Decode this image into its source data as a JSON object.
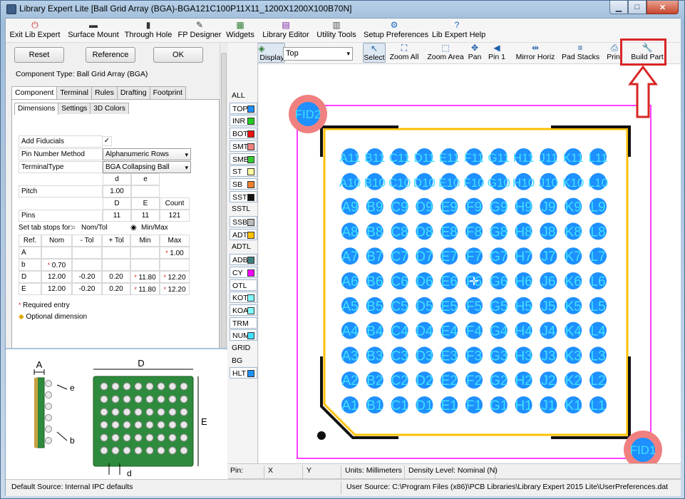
{
  "window": {
    "title": "Library Expert Lite [Ball Grid Array (BGA)-BGA121C100P11X11_1200X1200X100B70N]"
  },
  "menu": [
    {
      "label": "Exit Lib Expert",
      "icon": "power-icon",
      "icon_glyph": "⏻",
      "color": "#c92a2a"
    },
    {
      "label": "Surface Mount",
      "icon": "smd-chip-icon",
      "icon_glyph": "▬",
      "color": "#333"
    },
    {
      "label": "Through Hole",
      "icon": "through-hole-icon",
      "icon_glyph": "▮",
      "color": "#333"
    },
    {
      "label": "FP Designer",
      "icon": "footprint-designer-icon",
      "icon_glyph": "✎",
      "color": "#333"
    },
    {
      "label": "Widgets",
      "icon": "widgets-icon",
      "icon_glyph": "▦",
      "color": "#2e7d32"
    },
    {
      "label": "Library Editor",
      "icon": "library-editor-icon",
      "icon_glyph": "▤",
      "color": "#7b1fa2"
    },
    {
      "label": "Utility Tools",
      "icon": "utility-tools-icon",
      "icon_glyph": "▥",
      "color": "#555"
    },
    {
      "label": "Setup Preferences",
      "icon": "setup-preferences-icon",
      "icon_glyph": "⚙",
      "color": "#1565c0"
    },
    {
      "label": "Lib Expert Help",
      "icon": "help-icon",
      "icon_glyph": "?",
      "color": "#1565c0"
    }
  ],
  "buttons": {
    "reset": "Reset",
    "reference": "Reference",
    "ok": "OK"
  },
  "component_type": "Component Type: Ball Grid Array (BGA)",
  "tabs": [
    "Component",
    "Terminal",
    "Rules",
    "Drafting",
    "Footprint"
  ],
  "subtabs": [
    "Dimensions",
    "Settings",
    "3D Colors"
  ],
  "form": {
    "add_fiducials": "Add Fiducials",
    "pin_number_method_label": "Pin Number Method",
    "pin_number_method_value": "Alphanumeric Rows",
    "terminal_type_label": "TerminalType",
    "terminal_type_value": "BGA Collapsing Ball",
    "col_d": "d",
    "col_e": "e",
    "pitch_label": "Pitch",
    "pitch_value": "1.00",
    "col_D": "D",
    "col_E": "E",
    "col_count": "Count",
    "pins_label": "Pins",
    "pins_D": "11",
    "pins_E": "11",
    "pins_count": "121",
    "tab_stops_label": "Set tab stops for:",
    "radio_nom": "Nom/Tol",
    "radio_minmax": "Min/Max",
    "headers": [
      "Ref.",
      "Nom",
      "- Tol",
      "+ Tol",
      "Min",
      "Max"
    ],
    "rows": [
      {
        "ref": "A",
        "nom": "",
        "ntol": "",
        "ptol": "",
        "min": "",
        "max": "1.00",
        "max_req": true
      },
      {
        "ref": "b",
        "nom": "0.70",
        "nom_req": true,
        "ntol": "",
        "ptol": "",
        "min": "",
        "max": ""
      },
      {
        "ref": "D",
        "nom": "12.00",
        "ntol": "-0.20",
        "ptol": "0.20",
        "min": "11.80",
        "max": "12.20",
        "min_req": true,
        "max_req": true
      },
      {
        "ref": "E",
        "nom": "12.00",
        "ntol": "-0.20",
        "ptol": "0.20",
        "min": "11.80",
        "max": "12.20",
        "min_req": true,
        "max_req": true
      }
    ],
    "legend_required": "Required entry",
    "legend_optional": "Optional dimension"
  },
  "diagram_labels": {
    "A": "A",
    "D": "D",
    "E": "E",
    "e": "e",
    "b": "b",
    "d": "d"
  },
  "layers": [
    {
      "name": "ALL",
      "color": ""
    },
    {
      "name": "TOP",
      "color": "#1e90ff"
    },
    {
      "name": "INR",
      "color": "#22cc22"
    },
    {
      "name": "BOT",
      "color": "#ee1111"
    },
    {
      "name": "SMT",
      "color": "#f08080"
    },
    {
      "name": "SMB",
      "color": "#33cc33"
    },
    {
      "name": "ST",
      "color": "#ffffa0"
    },
    {
      "name": "SB",
      "color": "#f08030"
    },
    {
      "name": "SST",
      "color": "#111111"
    },
    {
      "name": "SSTL",
      "color": ""
    },
    {
      "name": "SSB",
      "color": "#bbbbbb"
    },
    {
      "name": "ADT",
      "color": "#ffc000"
    },
    {
      "name": "ADTL",
      "color": ""
    },
    {
      "name": "ADB",
      "color": "#408080"
    },
    {
      "name": "CY",
      "color": "#ff00ff"
    },
    {
      "name": "OTL",
      "color": ""
    },
    {
      "name": "KOT",
      "color": "#80ffff"
    },
    {
      "name": "KOA",
      "color": "#80ffff"
    },
    {
      "name": "TRM",
      "color": ""
    },
    {
      "name": "NUM",
      "color": "#40e0ff"
    },
    {
      "name": "GRID",
      "color": ""
    },
    {
      "name": "BG",
      "color": ""
    },
    {
      "name": "HLT",
      "color": "#1e90ff"
    }
  ],
  "toolbar": {
    "layer_display": "Layer Display",
    "layer_combo": "Top",
    "items": [
      {
        "label": "Select",
        "icon": "select-cursor-icon",
        "icon_glyph": "↖"
      },
      {
        "label": "Zoom All",
        "icon": "zoom-all-icon",
        "icon_glyph": "⛶"
      },
      {
        "label": "Zoom Area",
        "icon": "zoom-area-icon",
        "icon_glyph": "⬚"
      },
      {
        "label": "Pan",
        "icon": "pan-icon",
        "icon_glyph": "✥"
      },
      {
        "label": "Pin 1",
        "icon": "pin1-icon",
        "icon_glyph": "◀"
      },
      {
        "label": "Mirror Horiz",
        "icon": "mirror-horizontal-icon",
        "icon_glyph": "⇹"
      },
      {
        "label": "Pad Stacks",
        "icon": "pad-stacks-icon",
        "icon_glyph": "≡"
      },
      {
        "label": "Print",
        "icon": "print-icon",
        "icon_glyph": "⎙"
      },
      {
        "label": "Build Part",
        "icon": "build-part-icon",
        "icon_glyph": "🔧"
      }
    ]
  },
  "footprint": {
    "columns": [
      "A",
      "B",
      "C",
      "D",
      "E",
      "F",
      "G",
      "H",
      "J",
      "K",
      "L"
    ],
    "rows": 11,
    "fiducials": [
      "FID2",
      "FID1"
    ],
    "pad_color": "#1e90ff",
    "label_color": "#40e0ff",
    "assembly_color": "#ffc000",
    "silk_color": "#111111",
    "courtyard_color": "#ff00ff",
    "fiducial_color": "#f08080"
  },
  "status": {
    "pin": "Pin:",
    "x": "X",
    "y": "Y",
    "units": "Units: Millimeters",
    "density": "Density Level: Nominal (N)",
    "default_source": "Default Source:  Internal IPC defaults",
    "user_source": "User Source:  C:\\Program Files (x86)\\PCB Libraries\\Library Expert 2015 Lite\\UserPreferences.dat"
  }
}
